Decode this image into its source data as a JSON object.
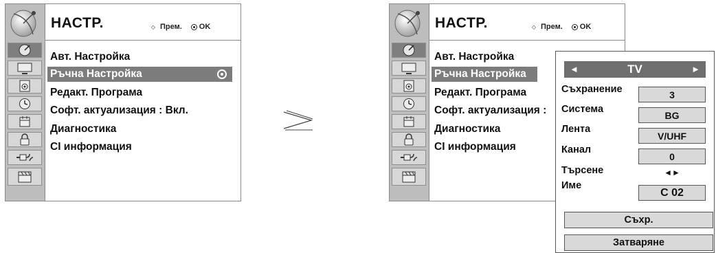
{
  "left_panel": {
    "title": "НАСТР.",
    "hint_move": "Прем.",
    "hint_ok": "OK",
    "menu": [
      {
        "label": "Авт. Настройка"
      },
      {
        "label": "Ръчна Настройка",
        "selected": true
      },
      {
        "label": "Редакт. Програма"
      },
      {
        "label": "Софт. актуализация  : Вкл."
      },
      {
        "label": "Диагностика"
      },
      {
        "label": "CI информация"
      }
    ]
  },
  "right_panel": {
    "title": "НАСТР.",
    "hint_move": "Прем.",
    "hint_ok": "OK",
    "menu": [
      {
        "label": "Авт. Настройка"
      },
      {
        "label": "Ръчна Настройка",
        "selected": true
      },
      {
        "label": "Редакт. Програма"
      },
      {
        "label": "Софт. актуализация  :"
      },
      {
        "label": "Диагностика"
      },
      {
        "label": "CI информация"
      }
    ]
  },
  "sidebar_icons": [
    "satellite-dish-icon",
    "monitor-icon",
    "speaker-icon",
    "clock-icon",
    "calendar-icon",
    "lock-icon",
    "input-plug-icon",
    "clapperboard-icon"
  ],
  "arrow_symbol": "≥",
  "manual_tuning": {
    "source_prev": "◄",
    "source_value": "TV",
    "source_next": "►",
    "rows": [
      {
        "label": "Съхранение",
        "value": "3"
      },
      {
        "label": "Система",
        "value": "BG"
      },
      {
        "label": "Лента",
        "value": "V/UHF"
      },
      {
        "label": "Канал",
        "value": "0"
      },
      {
        "label": "Търсене",
        "value": "◄►"
      },
      {
        "label": "Име",
        "value": "C  02"
      }
    ],
    "save_button": "Съхр.",
    "close_button": "Затваряне"
  },
  "colors": {
    "sidebar_bg": "#bdbdbd",
    "selection_bg": "#7c7c7c",
    "box_bg": "#d9d9d9"
  }
}
